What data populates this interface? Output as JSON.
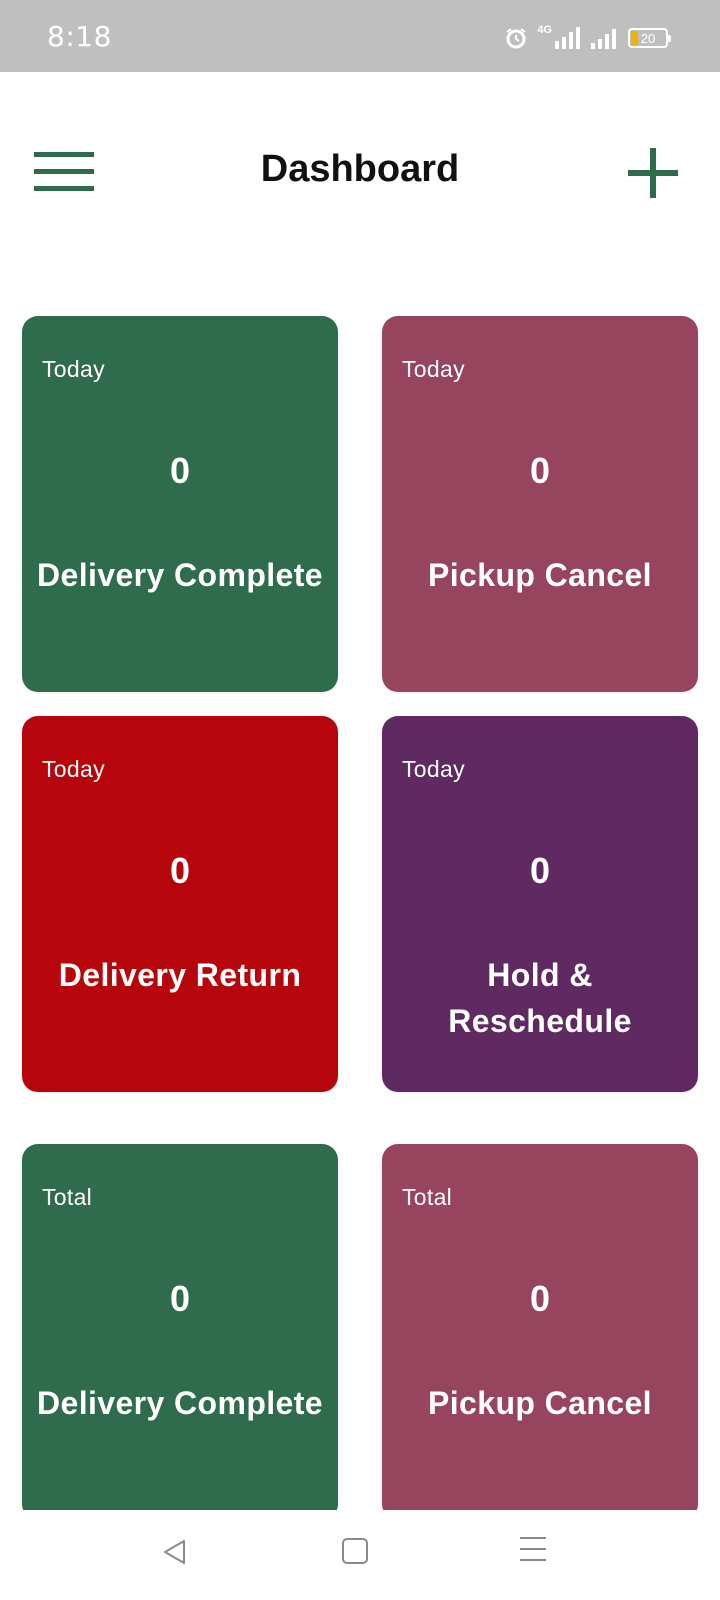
{
  "status_bar": {
    "time": "8:18",
    "network": "4G",
    "battery": "20",
    "icons": [
      "alarm-icon",
      "signal-4g-icon",
      "signal-icon",
      "battery-icon"
    ]
  },
  "header": {
    "title": "Dashboard",
    "menu_icon": "hamburger-menu-icon",
    "add_icon": "plus-icon"
  },
  "colors": {
    "accent": "#2f6b4d",
    "delivery_complete": "#2f6b4d",
    "pickup_cancel": "#97445f",
    "delivery_return": "#b7060b",
    "hold_reschedule": "#5f2961"
  },
  "cards": [
    {
      "period": "Today",
      "count": "0",
      "label": "Delivery Complete",
      "color": "#2f6b4d"
    },
    {
      "period": "Today",
      "count": "0",
      "label": "Pickup Cancel",
      "color": "#97445f"
    },
    {
      "period": "Today",
      "count": "0",
      "label": "Delivery Return",
      "color": "#b7060b"
    },
    {
      "period": "Today",
      "count": "0",
      "label": "Hold & Reschedule",
      "color": "#5f2961"
    },
    {
      "period": "Total",
      "count": "0",
      "label": "Delivery Complete",
      "color": "#2f6b4d"
    },
    {
      "period": "Total",
      "count": "0",
      "label": "Pickup Cancel",
      "color": "#97445f"
    }
  ],
  "nav": {
    "icons": [
      "back-icon",
      "home-icon",
      "recents-icon"
    ]
  }
}
